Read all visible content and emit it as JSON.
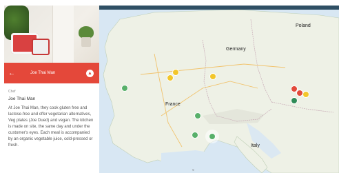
{
  "panel": {
    "header_title": "Joe Thai Man",
    "section_label": "Chef",
    "restaurant_name": "Joe Thai Man",
    "description": "At Joe Thai Man, they cook gluten free and lactose-free and offer vegetarian alternatives, Veg plates (Joe Dued) and vegan. The kitchen is made on site, the same day and under the customer's eyes. Each meal is accompanied by an organic vegetable juice, cold-pressed or fresh.",
    "back_icon": "arrow-left-icon",
    "badge_icon": "route-icon"
  },
  "map": {
    "countries": {
      "germany": "Germany",
      "france": "France",
      "italy": "Italy",
      "poland": "Poland"
    },
    "markers": [
      {
        "color": "green"
      },
      {
        "color": "yellow"
      },
      {
        "color": "yellow"
      },
      {
        "color": "green"
      },
      {
        "color": "green"
      },
      {
        "color": "green"
      },
      {
        "color": "red"
      },
      {
        "color": "yellow"
      },
      {
        "color": "darkgreen"
      }
    ]
  },
  "colors": {
    "accent_red": "#e4483a",
    "map_water": "#d8e7f3",
    "map_land": "#eef1e6",
    "toolbar": "#2f4f64"
  }
}
